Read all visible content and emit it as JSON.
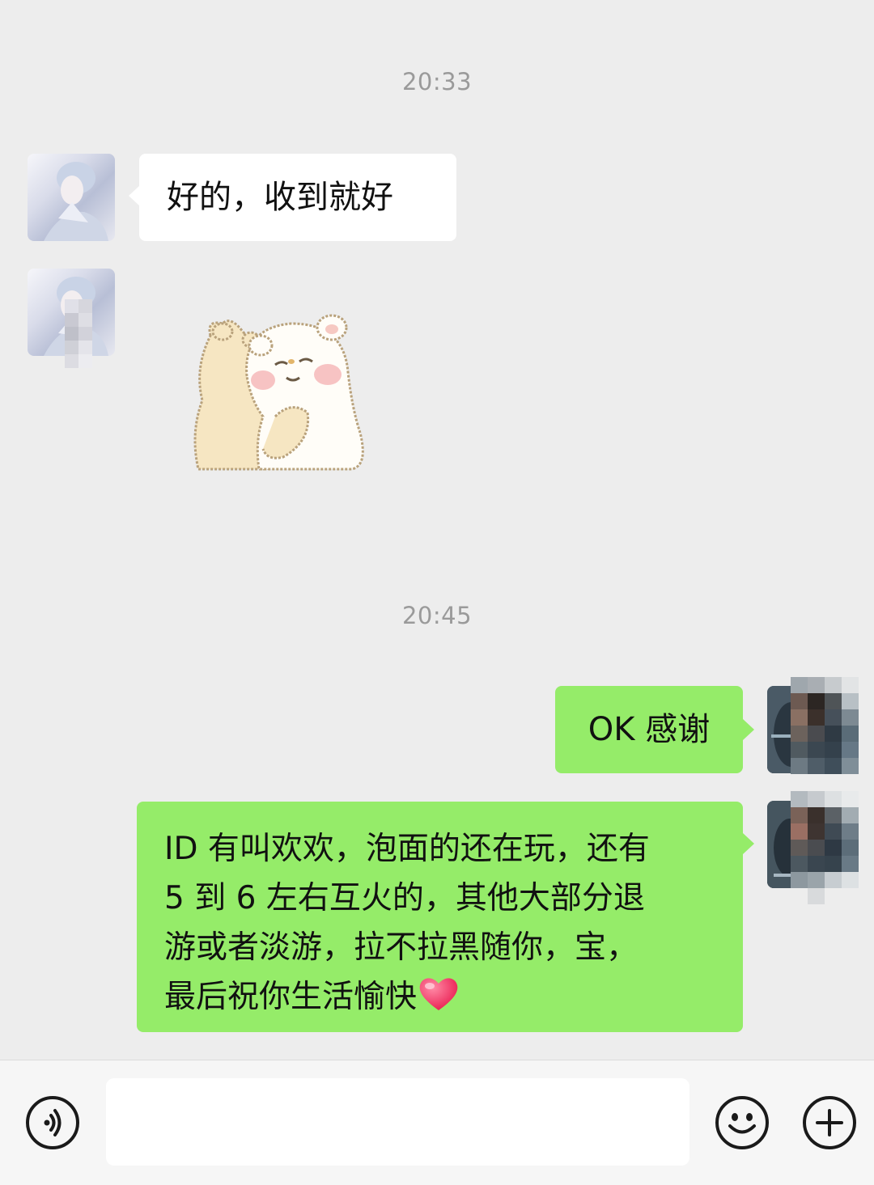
{
  "chat": {
    "timestamps": [
      "20:33",
      "20:45"
    ],
    "messages": [
      {
        "sender": "contact",
        "type": "text",
        "text": "好的，收到就好"
      },
      {
        "sender": "contact",
        "type": "sticker",
        "sticker": "bear-hug-sticker"
      },
      {
        "sender": "me",
        "type": "text",
        "text": "OK 感谢"
      },
      {
        "sender": "me",
        "type": "text",
        "lines": [
          "ID 有叫欢欢，泡面的还在玩，还有",
          "5 到 6 左右互火的，其他大部分退",
          "游或者淡游，拉不拉黑随你，宝，",
          "最后祝你生活愉快"
        ],
        "emoji": "heart"
      }
    ]
  },
  "input_bar": {
    "voice_icon": "voice-icon",
    "text_value": "",
    "emoji_icon": "smiley-icon",
    "more_icon": "plus-icon"
  },
  "colors": {
    "background": "#ededed",
    "sent_bubble": "#95ec69",
    "received_bubble": "#ffffff",
    "timestamp": "#9a9a9a"
  }
}
